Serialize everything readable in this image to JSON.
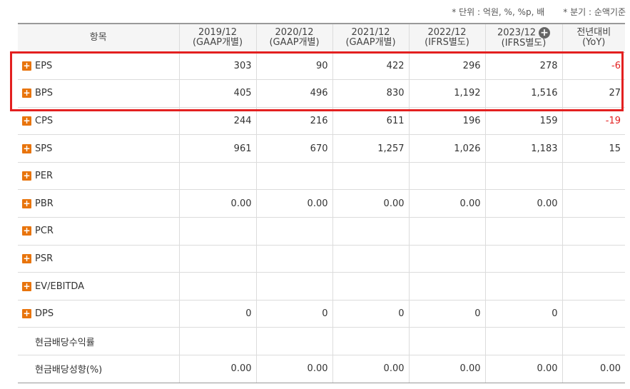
{
  "notes": {
    "unit": "* 단위 : 억원, %, %p, 배",
    "basis": "* 분기 : 순액기준"
  },
  "header": {
    "item_label": "항목",
    "columns": [
      {
        "period": "2019/12",
        "basis": "(GAAP개별)"
      },
      {
        "period": "2020/12",
        "basis": "(GAAP개별)"
      },
      {
        "period": "2021/12",
        "basis": "(GAAP개별)"
      },
      {
        "period": "2022/12",
        "basis": "(IFRS별도)"
      },
      {
        "period": "2023/12",
        "basis": "(IFRS별도)",
        "expand_icon": "plus-circle-icon"
      }
    ],
    "yoy": {
      "title": "전년대비",
      "sub": "(YoY)"
    }
  },
  "rows": [
    {
      "label": "EPS",
      "expandable": true,
      "values": [
        "303",
        "90",
        "422",
        "296",
        "278"
      ],
      "yoy": "-6",
      "yoy_negative": true
    },
    {
      "label": "BPS",
      "expandable": true,
      "values": [
        "405",
        "496",
        "830",
        "1,192",
        "1,516"
      ],
      "yoy": "27",
      "yoy_negative": false
    },
    {
      "label": "CPS",
      "expandable": true,
      "values": [
        "244",
        "216",
        "611",
        "196",
        "159"
      ],
      "yoy": "-19",
      "yoy_negative": true
    },
    {
      "label": "SPS",
      "expandable": true,
      "values": [
        "961",
        "670",
        "1,257",
        "1,026",
        "1,183"
      ],
      "yoy": "15",
      "yoy_negative": false
    },
    {
      "label": "PER",
      "expandable": true,
      "values": [
        "",
        "",
        "",
        "",
        ""
      ],
      "yoy": "",
      "yoy_negative": false
    },
    {
      "label": "PBR",
      "expandable": true,
      "values": [
        "0.00",
        "0.00",
        "0.00",
        "0.00",
        "0.00"
      ],
      "yoy": "",
      "yoy_negative": false
    },
    {
      "label": "PCR",
      "expandable": true,
      "values": [
        "",
        "",
        "",
        "",
        ""
      ],
      "yoy": "",
      "yoy_negative": false
    },
    {
      "label": "PSR",
      "expandable": true,
      "values": [
        "",
        "",
        "",
        "",
        ""
      ],
      "yoy": "",
      "yoy_negative": false
    },
    {
      "label": "EV/EBITDA",
      "expandable": true,
      "values": [
        "",
        "",
        "",
        "",
        ""
      ],
      "yoy": "",
      "yoy_negative": false
    },
    {
      "label": "DPS",
      "expandable": true,
      "values": [
        "0",
        "0",
        "0",
        "0",
        "0"
      ],
      "yoy": "",
      "yoy_negative": false
    },
    {
      "label": "현금배당수익률",
      "expandable": false,
      "values": [
        "",
        "",
        "",
        "",
        ""
      ],
      "yoy": "",
      "yoy_negative": false
    },
    {
      "label": "현금배당성향(%)",
      "expandable": false,
      "values": [
        "0.00",
        "0.00",
        "0.00",
        "0.00",
        "0.00"
      ],
      "yoy": "0.00",
      "yoy_negative": false
    }
  ],
  "colors": {
    "negative": "#e32020",
    "expand_icon": "#e8740c",
    "highlight_box": "#e32020"
  }
}
